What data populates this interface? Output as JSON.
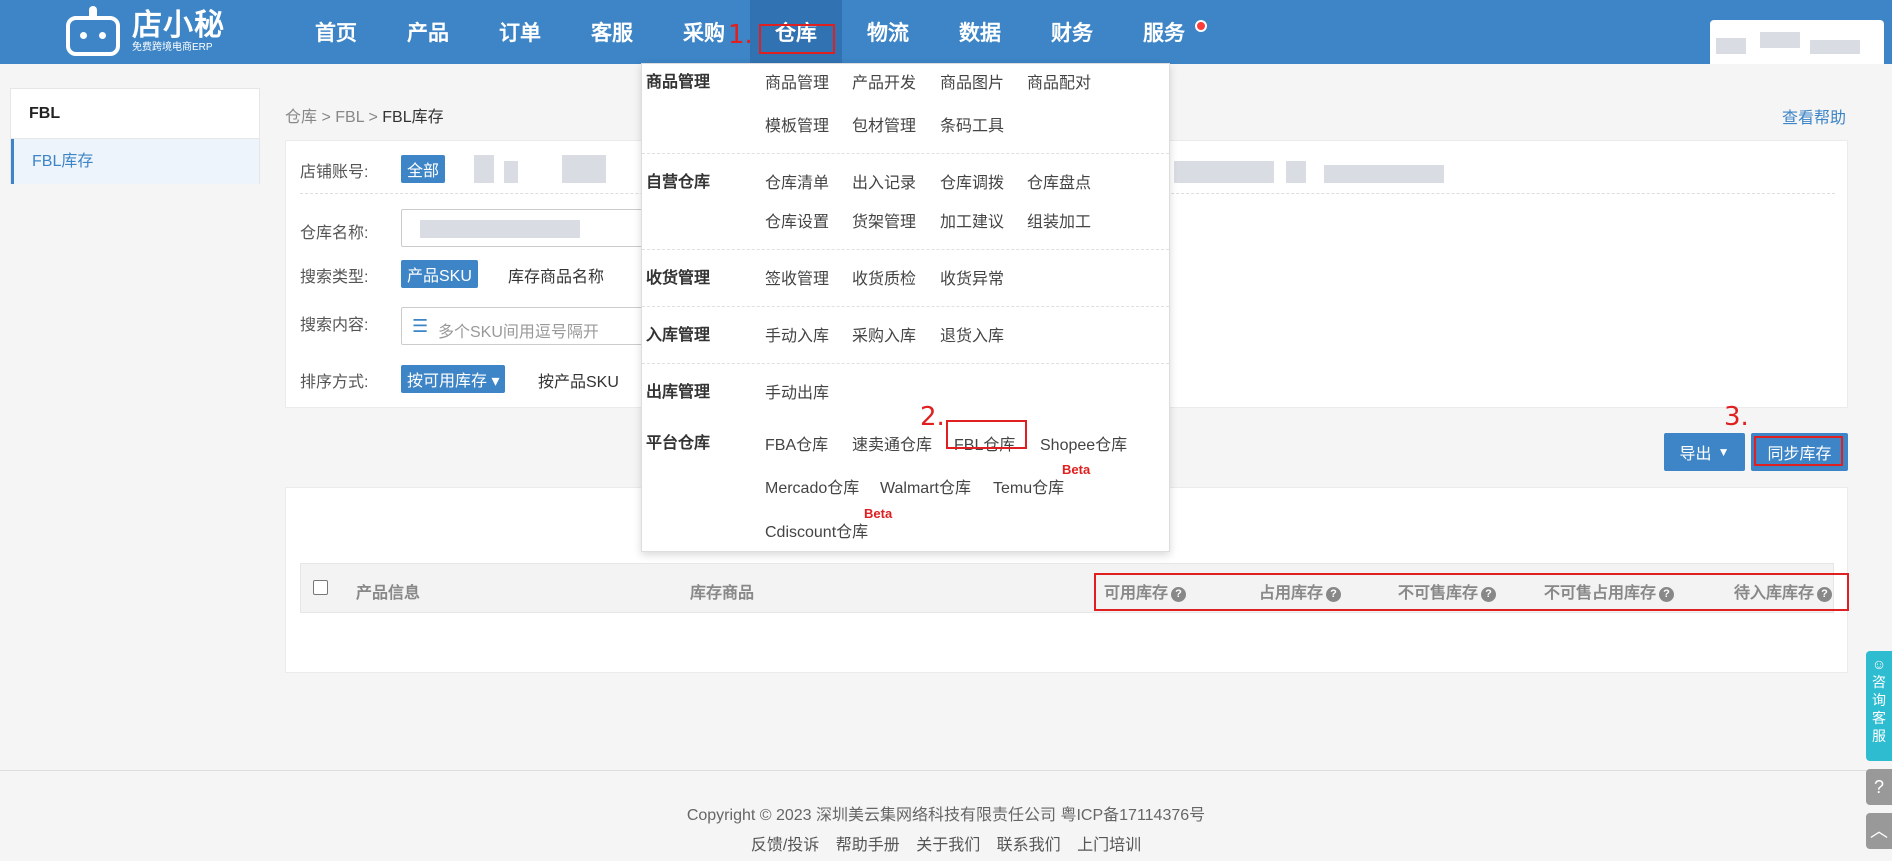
{
  "brand": {
    "name": "店小秘",
    "tagline": "免费跨境电商ERP"
  },
  "nav": {
    "items": [
      "首页",
      "产品",
      "订单",
      "客服",
      "采购",
      "仓库",
      "物流",
      "数据",
      "财务",
      "服务"
    ],
    "active_index": 5
  },
  "annotations": {
    "step1": "1.",
    "step2": "2.",
    "step3": "3."
  },
  "sidebar": {
    "header": "FBL",
    "items": [
      "FBL库存"
    ]
  },
  "breadcrumb": {
    "parts": [
      "仓库",
      "FBL",
      "FBL库存"
    ],
    "sep": ">"
  },
  "help_link": "查看帮助",
  "filters": {
    "shop_label": "店铺账号:",
    "shop_all": "全部",
    "warehouse_label": "仓库名称:",
    "search_type_label": "搜索类型:",
    "search_types": [
      "产品SKU",
      "库存商品名称"
    ],
    "search_content_label": "搜索内容:",
    "search_placeholder": "多个SKU间用逗号隔开",
    "sort_label": "排序方式:",
    "sort_options": [
      "按可用库存 ▾",
      "按产品SKU"
    ]
  },
  "buttons": {
    "export": "导出",
    "sync": "同步库存"
  },
  "table": {
    "headers": [
      "产品信息",
      "库存商品",
      "可用库存",
      "占用库存",
      "不可售库存",
      "不可售占用库存",
      "待入库库存"
    ]
  },
  "menu": {
    "sections": [
      {
        "title": "商品管理",
        "rows": [
          [
            "商品管理",
            "产品开发",
            "商品图片",
            "商品配对"
          ],
          [
            "模板管理",
            "包材管理",
            "条码工具"
          ]
        ]
      },
      {
        "title": "自营仓库",
        "rows": [
          [
            "仓库清单",
            "出入记录",
            "仓库调拨",
            "仓库盘点"
          ],
          [
            "仓库设置",
            "货架管理",
            "加工建议",
            "组装加工"
          ]
        ]
      },
      {
        "title": "收货管理",
        "rows": [
          [
            "签收管理",
            "收货质检",
            "收货异常"
          ]
        ]
      },
      {
        "title": "入库管理",
        "rows": [
          [
            "手动入库",
            "采购入库",
            "退货入库"
          ]
        ]
      },
      {
        "title": "出库管理",
        "rows": [
          [
            "手动出库"
          ]
        ]
      },
      {
        "title": "平台仓库",
        "rows": [
          [
            "FBA仓库",
            "速卖通仓库",
            "FBL仓库",
            "Shopee仓库"
          ],
          [
            "Mercado仓库",
            "Walmart仓库",
            "Temu仓库"
          ],
          [
            "Cdiscount仓库"
          ]
        ]
      }
    ],
    "beta": "Beta"
  },
  "footer": {
    "copyright": "Copyright © 2023 深圳美云集网络科技有限责任公司  粤ICP备17114376号",
    "links": [
      "反馈/投诉",
      "帮助手册",
      "关于我们",
      "联系我们",
      "上门培训"
    ]
  },
  "float": {
    "consult": "咨询客服",
    "help": "?",
    "top": "︿"
  }
}
